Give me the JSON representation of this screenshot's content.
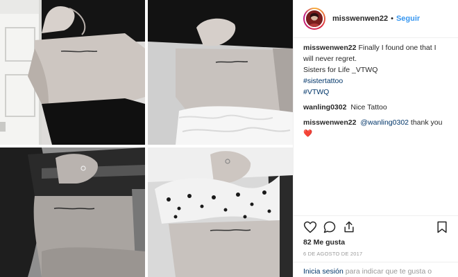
{
  "post": {
    "username": "misswenwen22",
    "separator": "•",
    "follow_label": "Seguir"
  },
  "caption": {
    "username": "misswenwen22",
    "text": "Finally I found one that I will never regret.",
    "line2": "Sisters for Life _VTWQ",
    "hashtag1": "#sistertattoo",
    "hashtag2": "#VTWQ"
  },
  "comments": [
    {
      "username": "wanling0302",
      "text": "Nice Tattoo"
    },
    {
      "username": "misswenwen22",
      "mention": "@wanling0302",
      "text": "thank you",
      "emoji": "❤️"
    }
  ],
  "icons": {
    "like": "heart-icon",
    "comment": "comment-icon",
    "share": "share-icon",
    "save": "bookmark-icon"
  },
  "stats": {
    "likes": "82 Me gusta",
    "date": "6 DE AGOSTO DE 2017"
  },
  "footer": {
    "login_link": "Inicia sesión",
    "login_text": "para indicar que te gusta o"
  },
  "colors": {
    "link": "#003569",
    "follow": "#3897f0",
    "heart": "#e0245e"
  }
}
